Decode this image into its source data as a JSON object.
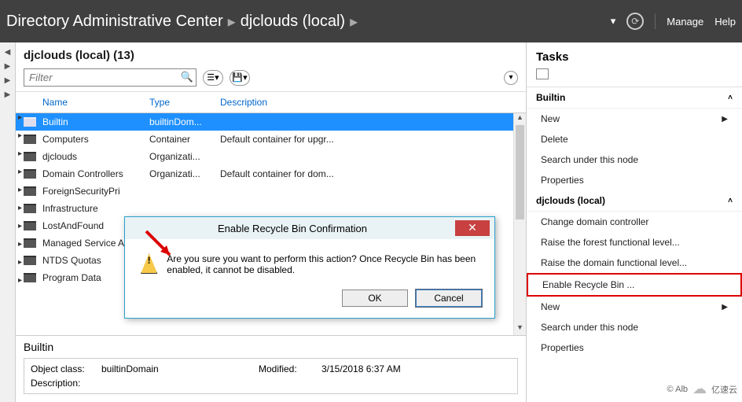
{
  "topbar": {
    "app": "Directory Administrative Center",
    "crumb": "djclouds (local)",
    "dropdown": "▾",
    "manage": "Manage",
    "help": "Help"
  },
  "center": {
    "title": "djclouds (local)  (13)",
    "filter_placeholder": "Filter",
    "columns": {
      "name": "Name",
      "type": "Type",
      "desc": "Description"
    },
    "rows": [
      {
        "name": "Builtin",
        "type": "builtinDom...",
        "desc": "",
        "sel": true
      },
      {
        "name": "Computers",
        "type": "Container",
        "desc": "Default container for upgr..."
      },
      {
        "name": "djclouds",
        "type": "Organizati...",
        "desc": ""
      },
      {
        "name": "Domain Controllers",
        "type": "Organizati...",
        "desc": "Default container for dom..."
      },
      {
        "name": "ForeignSecurityPri",
        "type": "",
        "desc": ""
      },
      {
        "name": "Infrastructure",
        "type": "",
        "desc": ""
      },
      {
        "name": "LostAndFound",
        "type": "",
        "desc": ""
      },
      {
        "name": "Managed Service A",
        "type": "",
        "desc": ""
      },
      {
        "name": "NTDS Quotas",
        "type": "",
        "desc": ""
      },
      {
        "name": "Program Data",
        "type": "",
        "desc": ""
      }
    ],
    "detail_title": "Builtin",
    "detail": {
      "objclass_l": "Object class:",
      "objclass_v": "builtinDomain",
      "mod_l": "Modified:",
      "mod_v": "3/15/2018 6:37 AM",
      "desc_l": "Description:"
    }
  },
  "tasks": {
    "title": "Tasks",
    "sec1": {
      "title": "Builtin",
      "items": [
        "New",
        "Delete",
        "Search under this node",
        "Properties"
      ]
    },
    "sec2": {
      "title": "djclouds (local)",
      "items": [
        "Change domain controller",
        "Raise the forest functional level...",
        "Raise the domain functional level...",
        "Enable Recycle Bin ...",
        "New",
        "Search under this node",
        "Properties"
      ],
      "highlight_index": 3
    }
  },
  "dialog": {
    "title": "Enable Recycle Bin Confirmation",
    "message": "Are you sure you want to perform this action? Once Recycle Bin has been enabled, it cannot be disabled.",
    "ok": "OK",
    "cancel": "Cancel"
  },
  "watermark": {
    "copy": "© Alb",
    "brand": "亿速云"
  }
}
